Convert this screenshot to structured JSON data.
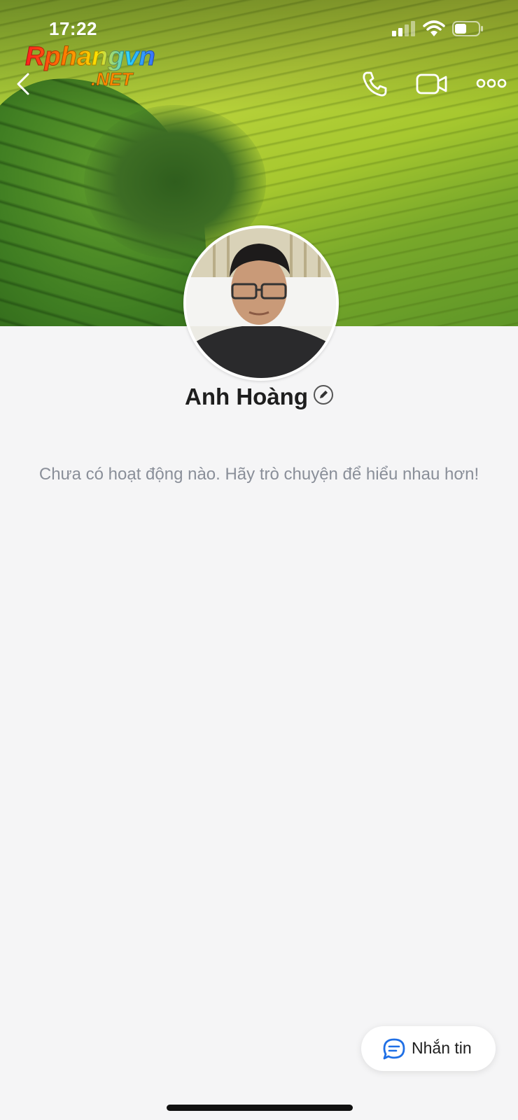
{
  "status_bar": {
    "time": "17:22"
  },
  "watermark": {
    "brand": "Rphangvn",
    "domain": ".NET"
  },
  "profile": {
    "name": "Anh Hoàng"
  },
  "activity": {
    "empty_message": "Chưa có hoạt động nào. Hãy trò chuyện để hiểu nhau hơn!"
  },
  "message_button": {
    "label": "Nhắn tin"
  },
  "icons": {
    "back": "chevron-left-icon",
    "call": "phone-icon",
    "video": "video-camera-icon",
    "more": "more-options-icon",
    "edit": "pencil-icon",
    "message": "chat-bubble-icon"
  },
  "colors": {
    "accent": "#1f6fe5",
    "background": "#f5f5f6",
    "muted_text": "#8a8f99"
  }
}
